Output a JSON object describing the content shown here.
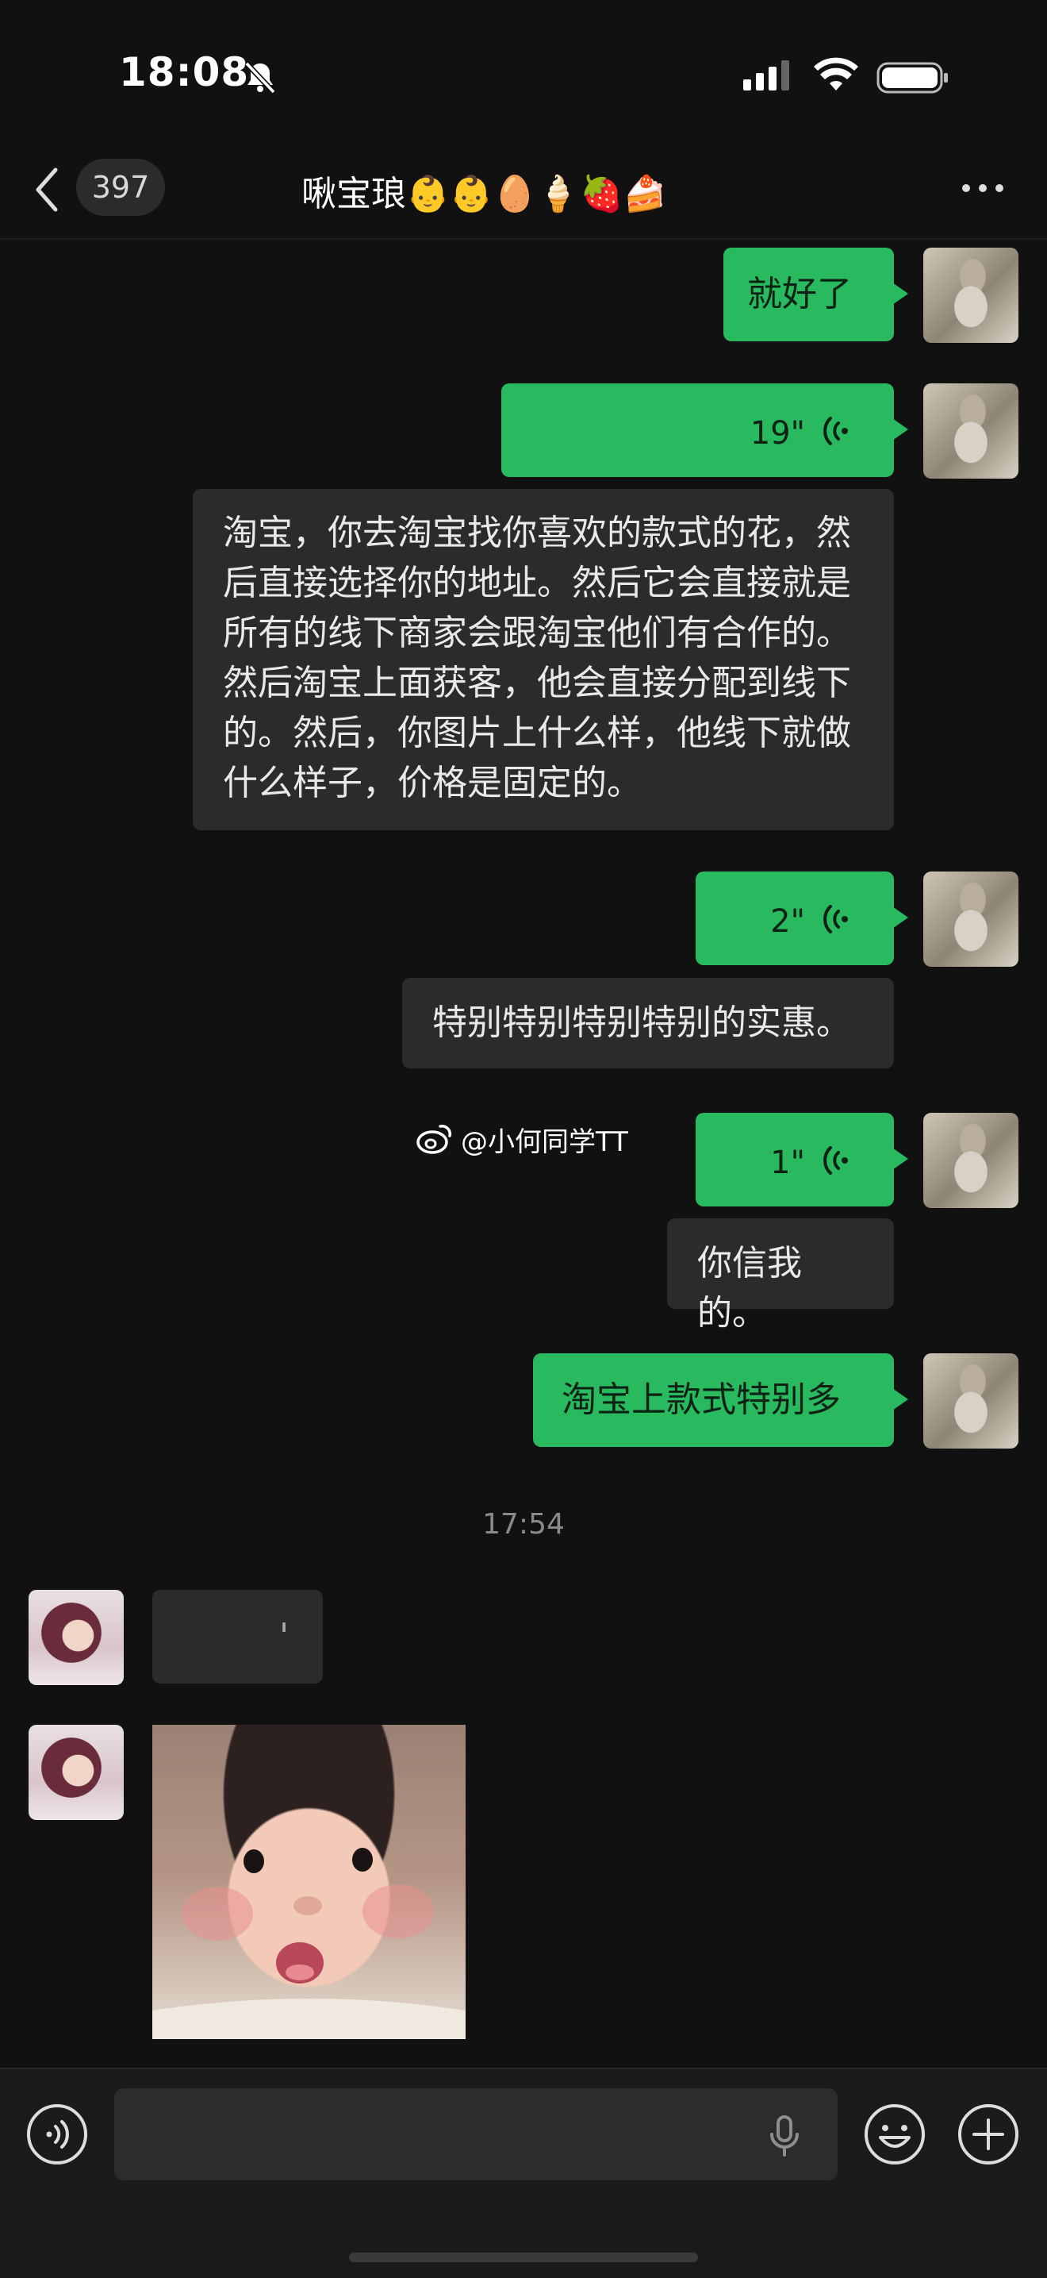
{
  "status_bar": {
    "time": "18:08",
    "icons": [
      "bell-slash-icon",
      "cellular-signal-icon",
      "wifi-icon",
      "battery-icon"
    ]
  },
  "header": {
    "back_icon": "chevron-left-icon",
    "unread_count": "397",
    "title": "啾宝琅👶👶🥚🍦🍓🍰",
    "more_icon": "more-dots-icon"
  },
  "messages": [
    {
      "side": "sent",
      "type": "text",
      "text": "就好了"
    },
    {
      "side": "sent",
      "type": "voice",
      "duration": "19\""
    },
    {
      "side": "sent",
      "type": "transcript",
      "text": "淘宝，你去淘宝找你喜欢的款式的花，然后直接选择你的地址。然后它会直接就是所有的线下商家会跟淘宝他们有合作的。然后淘宝上面获客，他会直接分配到线下的。然后，你图片上什么样，他线下就做什么样子，价格是固定的。"
    },
    {
      "side": "sent",
      "type": "voice",
      "duration": "2\""
    },
    {
      "side": "sent",
      "type": "transcript",
      "text": "特别特别特别特别的实惠。"
    },
    {
      "side": "sent",
      "type": "voice",
      "duration": "1\""
    },
    {
      "side": "sent",
      "type": "transcript",
      "text": "你信我的。"
    },
    {
      "side": "sent",
      "type": "text",
      "text": "淘宝上款式特别多"
    },
    {
      "type": "timestamp",
      "text": "17:54"
    },
    {
      "side": "received",
      "type": "text",
      "text": "'"
    },
    {
      "side": "received",
      "type": "image",
      "description": "baby-photo"
    }
  ],
  "watermark": {
    "text": "@小何同学TT"
  },
  "input_bar": {
    "placeholder": "",
    "icons": [
      "voice-toggle-icon",
      "microphone-icon",
      "emoji-icon",
      "plus-icon"
    ]
  },
  "colors": {
    "sent_bubble": "#29b95f",
    "received_bubble": "#2b2b2b",
    "background": "#111111"
  }
}
